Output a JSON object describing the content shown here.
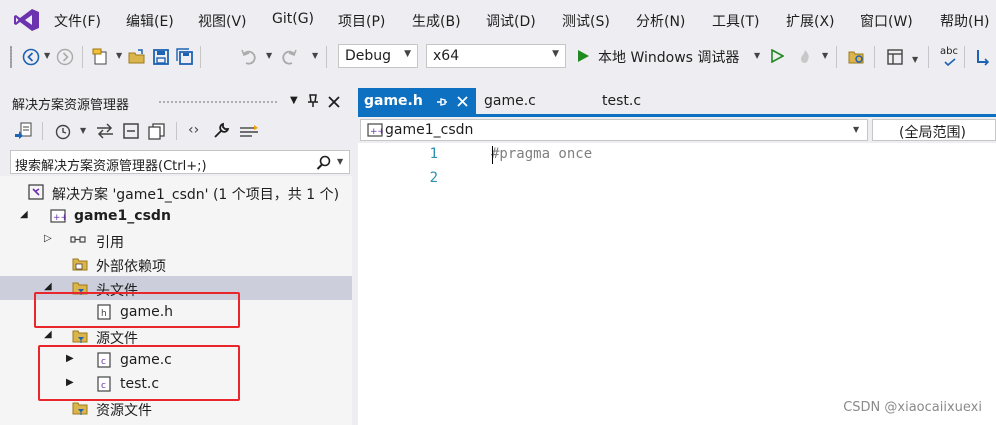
{
  "menu": {
    "items": [
      "文件(F)",
      "编辑(E)",
      "视图(V)",
      "Git(G)",
      "项目(P)",
      "生成(B)",
      "调试(D)",
      "测试(S)",
      "分析(N)",
      "工具(T)",
      "扩展(X)",
      "窗口(W)",
      "帮助(H)"
    ]
  },
  "toolbar": {
    "config": "Debug",
    "platform": "x64",
    "run_label": "本地 Windows 调试器",
    "spell_label": "abc"
  },
  "solution_explorer": {
    "title": "解决方案资源管理器",
    "pin_glyph": "▾ ⊥ ✕",
    "search_placeholder": "搜索解决方案资源管理器(Ctrl+;)",
    "tree": {
      "solution": "解决方案 'game1_csdn' (1 个项目，共 1 个)",
      "project": "game1_csdn",
      "references": "引用",
      "external_deps": "外部依赖项",
      "header_files": "头文件",
      "game_h": "game.h",
      "source_files": "源文件",
      "game_c": "game.c",
      "test_c": "test.c",
      "resource_files": "资源文件"
    }
  },
  "tabs": {
    "active": "game.h",
    "tab2": "game.c",
    "tab3": "test.c"
  },
  "navbar": {
    "project": "game1_csdn",
    "scope": "(全局范围)"
  },
  "editor": {
    "line1": "1",
    "line2": "2",
    "code1": "#pragma once"
  },
  "watermark": "CSDN @xiaocaiixuexi",
  "colors": {
    "accent": "#0e70c0",
    "highlight_box": "#e8262c",
    "selected_row": "#cccedb"
  }
}
